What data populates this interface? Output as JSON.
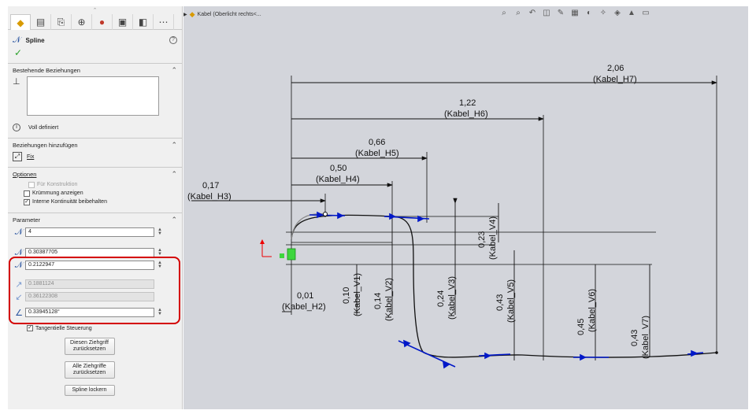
{
  "feature_tree_label": "Kabel  (Oberlicht rechts<...",
  "panel": {
    "title": "Spline",
    "sections": {
      "existing_relations": "Bestehende Beziehungen",
      "status": "Voll definiert",
      "add_relations": "Beziehungen hinzufügen",
      "fix_label": "Fix",
      "options": "Optionen",
      "parameters": "Parameter"
    },
    "options": [
      {
        "label": "Für Konstruktion",
        "checked": false,
        "enabled": false
      },
      {
        "label": "Krümmung anzeigen",
        "checked": false,
        "enabled": true
      },
      {
        "label": "Interne Kontinuität beibehalten",
        "checked": true,
        "enabled": true
      }
    ],
    "params": {
      "point_number": "4",
      "x": "0.30387705",
      "y": "0.2122947",
      "tangent_x": "0.1881124",
      "tangent_y": "0.36122308",
      "tangent_angle": "0.33945128°"
    },
    "tangent_control": "Tangentielle Steuerung",
    "buttons": {
      "reset_handle": "Diesen Ziehgriff zurücksetzen",
      "reset_all": "Alle Ziehgriffe zurücksetzen",
      "relax": "Spline lockern"
    }
  },
  "dimensions": {
    "h7_value": "2,06",
    "h7_name": "(Kabel_H7)",
    "h6_value": "1,22",
    "h6_name": "(Kabel_H6)",
    "h5_value": "0,66",
    "h5_name": "(Kabel_H5)",
    "h4_value": "0,50",
    "h4_name": "(Kabel_H4)",
    "h3_value": "0,17",
    "h3_name": "(Kabel_H3)",
    "h2_value": "0,01",
    "h2_name": "(Kabel_H2)",
    "v1_value": "0,10",
    "v1_name": "(Kabel_V1)",
    "v2_value": "0,14",
    "v2_name": "(Kabel_V2)",
    "v3_value": "0,24",
    "v3_name": "(Kabel_V3)",
    "v4_value": "0,23",
    "v4_name": "(Kabel_V4)",
    "v5_value": "0,43",
    "v5_name": "(Kabel_V5)",
    "v6_value": "0,45",
    "v6_name": "(Kabel_V6)",
    "v7_value": "0,43",
    "v7_name": "(Kabel_V7)"
  },
  "colors": {
    "panel_bg": "#f0f0f0",
    "canvas_bg": "#d3d5db",
    "highlight_red": "#d40000",
    "spline_blue": "#0018c8",
    "ok_green": "#2aa12a"
  }
}
